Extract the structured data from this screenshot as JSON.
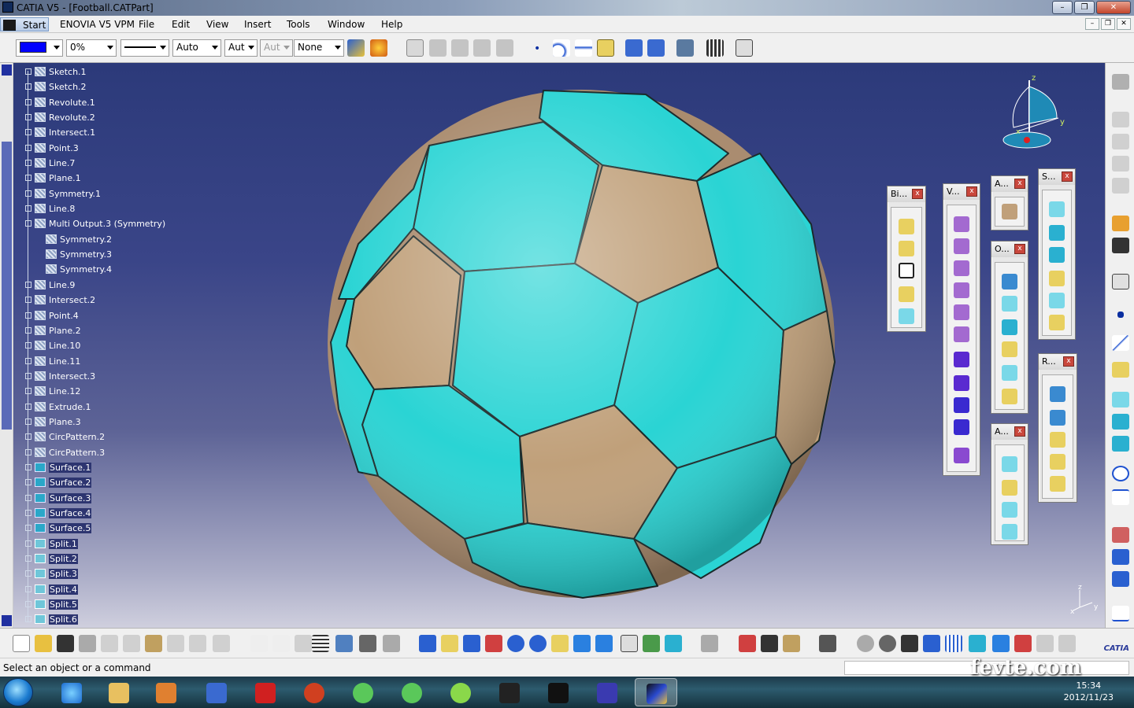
{
  "window": {
    "title": "CATIA V5 - [Football.CATPart]"
  },
  "menu": {
    "start": "Start",
    "items": [
      "ENOVIA V5 VPM",
      "File",
      "Edit",
      "View",
      "Insert",
      "Tools",
      "Window",
      "Help"
    ]
  },
  "toolbar1": {
    "color_swatch": "#0000ff",
    "transparency": "0%",
    "line_weight": "Auto",
    "layer_a": "Aut",
    "layer_b": "Aut",
    "layer_name": "None"
  },
  "tree": {
    "nodes": [
      {
        "label": "Sketch.1",
        "kind": "sketch"
      },
      {
        "label": "Sketch.2",
        "kind": "sketch"
      },
      {
        "label": "Revolute.1",
        "kind": "geom"
      },
      {
        "label": "Revolute.2",
        "kind": "geom"
      },
      {
        "label": "Intersect.1",
        "kind": "geom"
      },
      {
        "label": "Point.3",
        "kind": "geom"
      },
      {
        "label": "Line.7",
        "kind": "geom"
      },
      {
        "label": "Plane.1",
        "kind": "geom"
      },
      {
        "label": "Symmetry.1",
        "kind": "geom"
      },
      {
        "label": "Line.8",
        "kind": "geom"
      },
      {
        "label": "Multi Output.3 (Symmetry)",
        "kind": "geom"
      },
      {
        "label": "Symmetry.2",
        "kind": "child"
      },
      {
        "label": "Symmetry.3",
        "kind": "child"
      },
      {
        "label": "Symmetry.4",
        "kind": "child"
      },
      {
        "label": "Line.9",
        "kind": "geom"
      },
      {
        "label": "Intersect.2",
        "kind": "geom"
      },
      {
        "label": "Point.4",
        "kind": "geom"
      },
      {
        "label": "Plane.2",
        "kind": "geom"
      },
      {
        "label": "Line.10",
        "kind": "geom"
      },
      {
        "label": "Line.11",
        "kind": "geom"
      },
      {
        "label": "Intersect.3",
        "kind": "geom"
      },
      {
        "label": "Line.12",
        "kind": "geom"
      },
      {
        "label": "Extrude.1",
        "kind": "geom"
      },
      {
        "label": "Plane.3",
        "kind": "geom"
      },
      {
        "label": "CircPattern.2",
        "kind": "geom"
      },
      {
        "label": "CircPattern.3",
        "kind": "geom"
      },
      {
        "label": "Surface.1",
        "kind": "surface"
      },
      {
        "label": "Surface.2",
        "kind": "surface"
      },
      {
        "label": "Surface.3",
        "kind": "surface"
      },
      {
        "label": "Surface.4",
        "kind": "surface"
      },
      {
        "label": "Surface.5",
        "kind": "surface"
      },
      {
        "label": "Split.1",
        "kind": "split"
      },
      {
        "label": "Split.2",
        "kind": "split"
      },
      {
        "label": "Split.3",
        "kind": "split"
      },
      {
        "label": "Split.4",
        "kind": "split"
      },
      {
        "label": "Split.5",
        "kind": "split"
      },
      {
        "label": "Split.6",
        "kind": "split"
      }
    ]
  },
  "panels": [
    {
      "id": "bi",
      "title": "Bi...",
      "close": "x"
    },
    {
      "id": "v",
      "title": "V...",
      "close": "x"
    },
    {
      "id": "a1",
      "title": "A...",
      "close": "x"
    },
    {
      "id": "o",
      "title": "O...",
      "close": "x"
    },
    {
      "id": "a2",
      "title": "A...",
      "close": "x"
    },
    {
      "id": "s",
      "title": "S...",
      "close": "x"
    },
    {
      "id": "r",
      "title": "R...",
      "close": "x"
    }
  ],
  "compass": {
    "z": "z",
    "y": "y",
    "x": "x"
  },
  "mini_axes": {
    "z": "z",
    "x": "x",
    "y": "y"
  },
  "status": {
    "message": "Select an object or a command"
  },
  "watermark": "fevte.com",
  "clock": {
    "time": "15:34",
    "date": "2012/11/23"
  },
  "brand": "CATIA",
  "colors": {
    "background_top": "#2c3a7a",
    "panel_cyan": "#2ad4d4",
    "panel_tan": "#b89a74"
  }
}
